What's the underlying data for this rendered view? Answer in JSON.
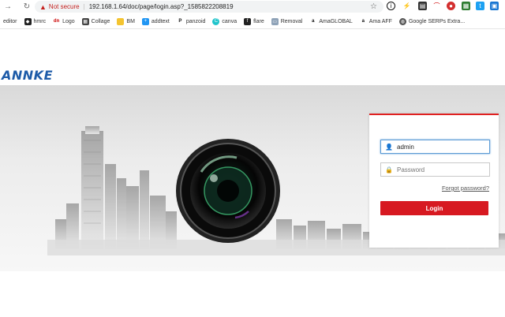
{
  "browser": {
    "security_label": "Not secure",
    "url": "192.168.1.64/doc/page/login.asp?_1585822208819",
    "bookmarks": [
      "editor",
      "hmrc",
      "Logo",
      "Collage",
      "BM",
      "addtext",
      "panzoid",
      "canva",
      "flare",
      "Removal",
      "AmaGLOBAL",
      "Ama AFF",
      "Google SERPs Extra..."
    ]
  },
  "brand": {
    "name": "ANNKE"
  },
  "login": {
    "username_value": "admin",
    "password_placeholder": "Password",
    "forgot_label": "Forgot password?",
    "login_button": "Login"
  },
  "colors": {
    "accent": "#d71921",
    "brand": "#1d5ba8"
  }
}
